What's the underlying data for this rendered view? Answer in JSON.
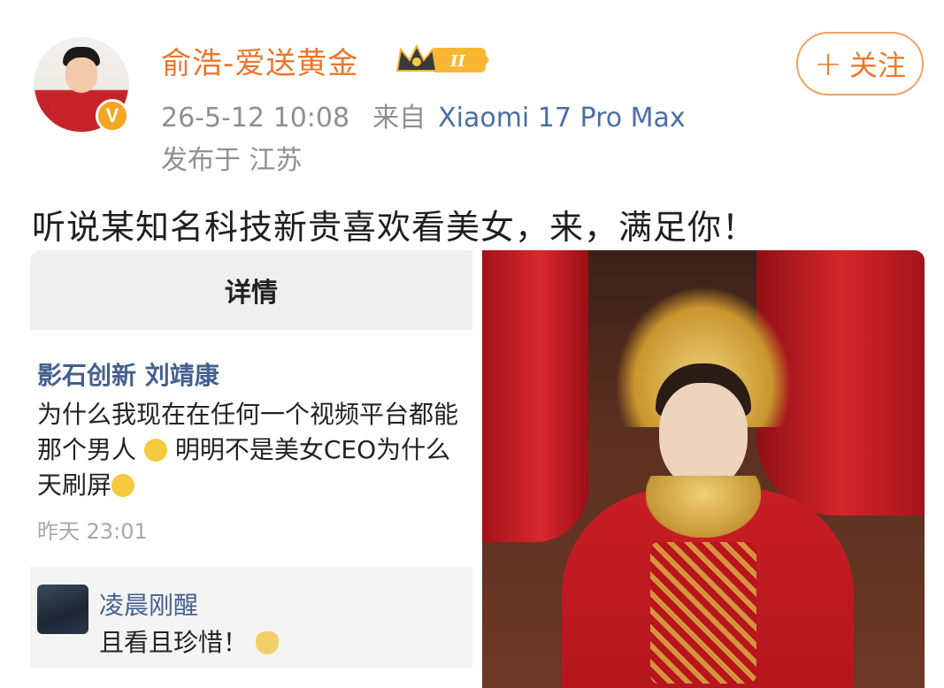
{
  "post": {
    "username": "俞浩-爱送黄金",
    "badge_level": "II",
    "follow_label": "关注",
    "follow_plus": "+",
    "date": "26-5-12 10:08",
    "source_prefix": "来自",
    "device": "Xiaomi 17 Pro Max",
    "location": "发布于 江苏",
    "text": "听说某知名科技新贵喜欢看美女，来，满足你！",
    "verified_mark": "V"
  },
  "screenshot": {
    "header": "详情",
    "comment_user": "影石创新 刘靖康",
    "comment_text_line1": "为什么我现在在任何一个视频平台都能",
    "comment_text_line2": "那个男人",
    "comment_text_line2b": " 明明不是美女CEO为什么",
    "comment_text_line3": "天刷屏",
    "comment_time": "昨天 23:01",
    "reply_user": "凌晨刚醒",
    "reply_text": "且看且珍惜！"
  },
  "colors": {
    "username": "#e8762c",
    "follow": "#ea7a2c",
    "device_link": "#4a6fa5",
    "verified": "#f5a623"
  },
  "icons": {
    "crown_badge": "crown-icon",
    "verified": "verified-v-icon",
    "emoji_cry": "crying-emoji-icon",
    "emoji_cat": "cat-emoji-icon"
  }
}
